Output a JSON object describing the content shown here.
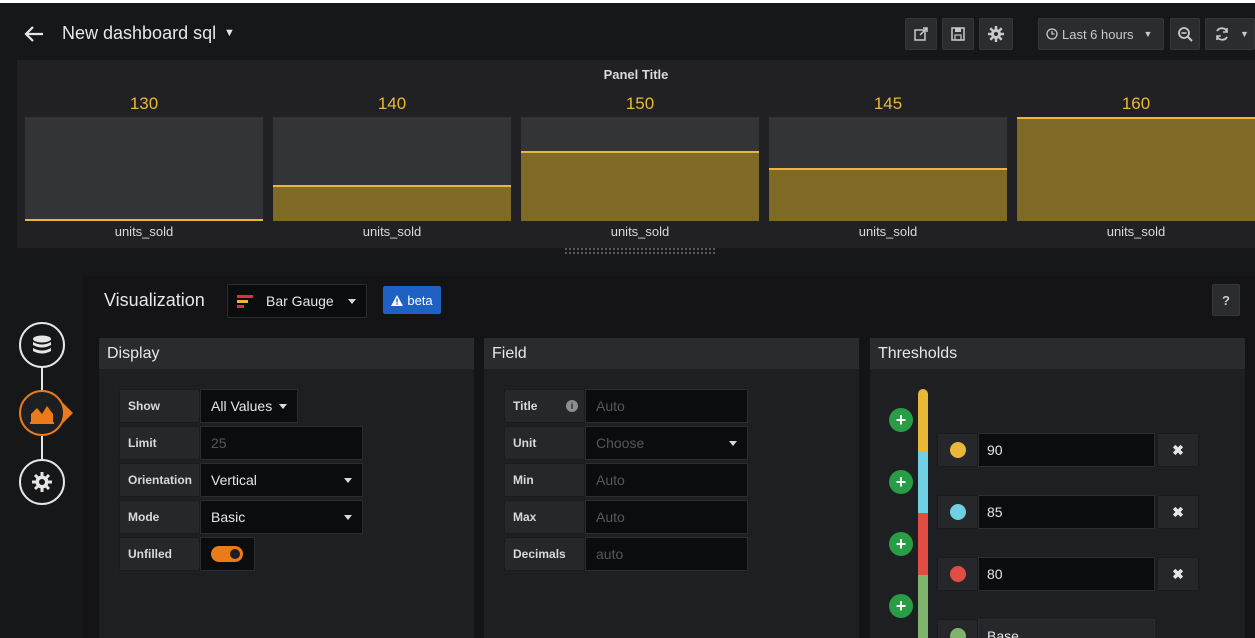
{
  "header": {
    "title": "New dashboard sql",
    "time_range": "Last 6 hours",
    "icons": [
      "back-arrow-icon",
      "share-icon",
      "save-icon",
      "settings-gear-icon",
      "clock-icon",
      "zoom-out-icon",
      "refresh-icon"
    ]
  },
  "panel": {
    "title": "Panel Title",
    "gauges": [
      {
        "value": "130",
        "label": "units_sold",
        "fill_fraction": 0.0
      },
      {
        "value": "140",
        "label": "units_sold",
        "fill_fraction": 0.33
      },
      {
        "value": "150",
        "label": "units_sold",
        "fill_fraction": 0.67
      },
      {
        "value": "145",
        "label": "units_sold",
        "fill_fraction": 0.5
      },
      {
        "value": "160",
        "label": "units_sold",
        "fill_fraction": 1.0
      }
    ]
  },
  "editor": {
    "visualization_label": "Visualization",
    "visualization_type": "Bar Gauge",
    "beta_label": "beta",
    "help_label": "?"
  },
  "display": {
    "heading": "Display",
    "show_label": "Show",
    "show_value": "All Values",
    "limit_label": "Limit",
    "limit_placeholder": "25",
    "orientation_label": "Orientation",
    "orientation_value": "Vertical",
    "mode_label": "Mode",
    "mode_value": "Basic",
    "unfilled_label": "Unfilled",
    "unfilled_on": true
  },
  "field": {
    "heading": "Field",
    "title_label": "Title",
    "title_placeholder": "Auto",
    "unit_label": "Unit",
    "unit_placeholder": "Choose",
    "min_label": "Min",
    "min_placeholder": "Auto",
    "max_label": "Max",
    "max_placeholder": "Auto",
    "decimals_label": "Decimals",
    "decimals_placeholder": "auto"
  },
  "thresholds": {
    "heading": "Thresholds",
    "items": [
      {
        "value": "90",
        "color": "#eab839"
      },
      {
        "value": "85",
        "color": "#6ed0e0"
      },
      {
        "value": "80",
        "color": "#ef843c"
      },
      {
        "value": "Base",
        "color": "#7eb26d"
      }
    ]
  },
  "colors": {
    "accent": "#eab839",
    "primary": "#1f60c4",
    "success": "#299c46"
  }
}
